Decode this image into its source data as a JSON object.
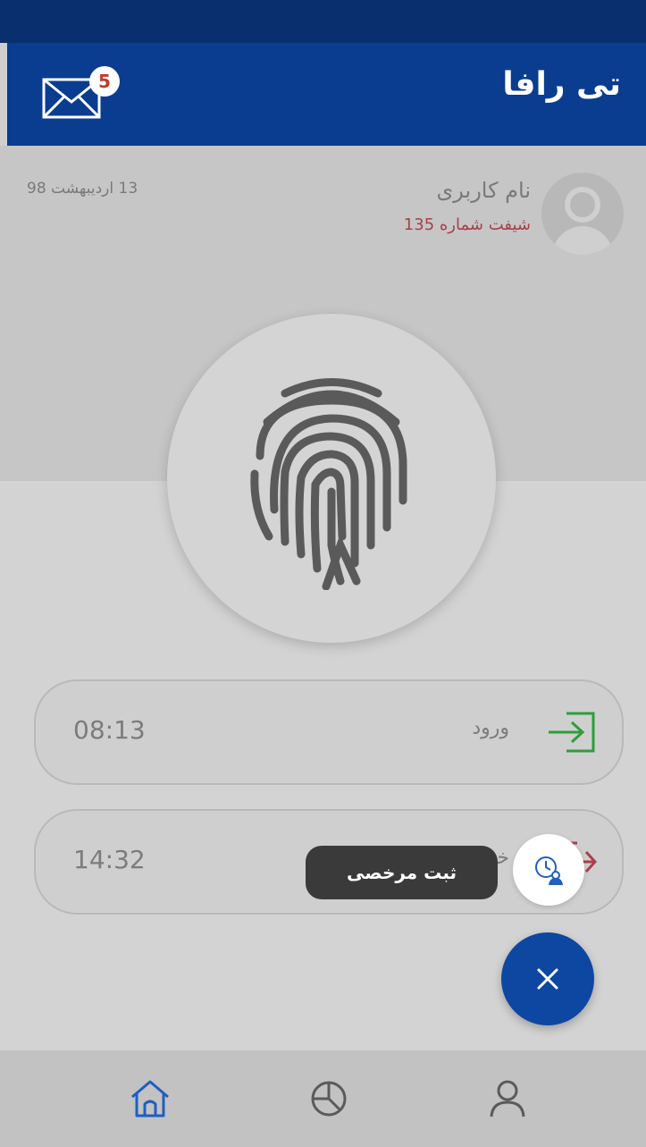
{
  "header": {
    "title": "تی رافا",
    "mail_badge": "5",
    "mail_icon": "envelope-icon"
  },
  "user": {
    "name": "نام کاربری",
    "shift": "شیفت شماره 135",
    "date": "13 اردیبهشت 98"
  },
  "fingerprint_icon": "fingerprint-icon",
  "attendance": {
    "entry": {
      "label": "ورود",
      "time": "08:13",
      "icon": "sign-in-icon",
      "color": "#2e9d3a"
    },
    "exit": {
      "label": "خروج",
      "time": "14:32",
      "icon": "sign-out-icon",
      "color": "#a8404a"
    }
  },
  "fab_menu": {
    "leave_label": "ثبت مرخصی",
    "leave_icon": "clock-user-icon",
    "close_icon": "close-icon"
  },
  "bottom_nav": {
    "items": [
      {
        "icon": "home-icon"
      },
      {
        "icon": "pie-chart-icon"
      },
      {
        "icon": "user-icon"
      }
    ]
  },
  "colors": {
    "primary": "#0a3d8f",
    "fab": "#0d47a1",
    "shift_text": "#a8404a"
  }
}
